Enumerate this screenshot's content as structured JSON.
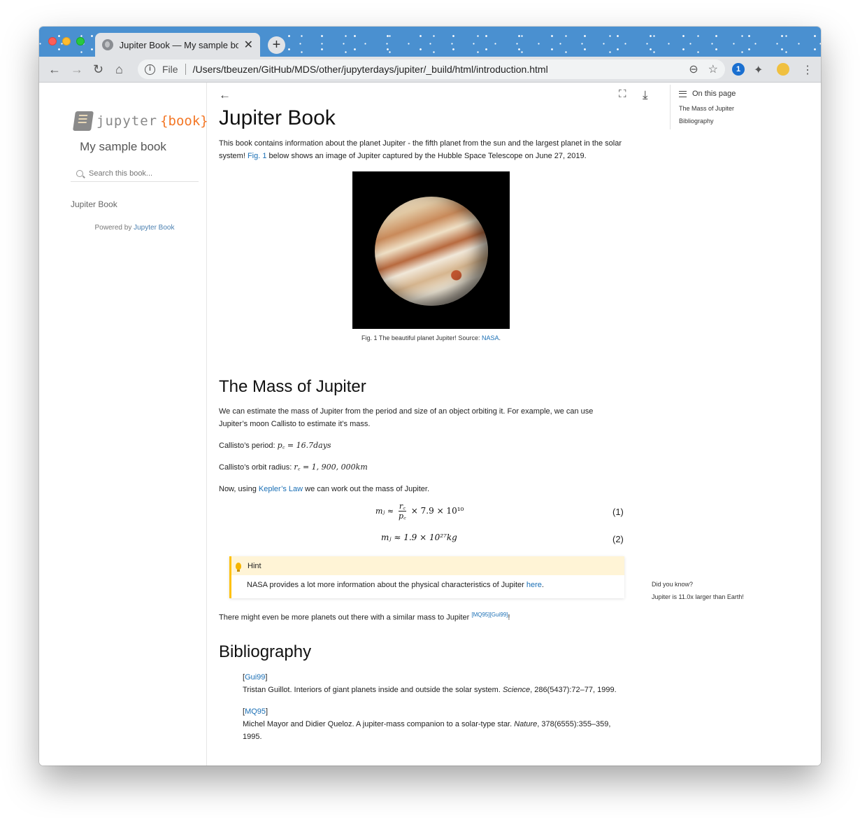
{
  "browser": {
    "tab_title": "Jupiter Book — My sample book",
    "address_scheme": "File",
    "address_url": "/Users/tbeuzen/GitHub/MDS/other/jupyterdays/jupiter/_build/html/introduction.html",
    "onepassword_label": "1"
  },
  "sidebar": {
    "logo_word": "jupyter",
    "logo_book_word": "{book}",
    "site_title": "My sample book",
    "search_placeholder": "Search this book...",
    "nav_items": [
      "Jupiter Book"
    ],
    "powered_prefix": "Powered by ",
    "powered_link": "Jupyter Book"
  },
  "toc": {
    "heading": "On this page",
    "items": [
      "The Mass of Jupiter",
      "Bibliography"
    ]
  },
  "article": {
    "title": "Jupiter Book",
    "intro_pre": "This book contains information about the planet Jupiter - the fifth planet from the sun and the largest planet in the solar system! ",
    "intro_link": "Fig. 1",
    "intro_post": " below shows an image of Jupiter captured by the Hubble Space Telescope on June 27, 2019.",
    "figure_caption_pre": "Fig. 1 The beautiful planet Jupiter! Source: ",
    "figure_caption_link": "NASA",
    "figure_caption_post": ".",
    "section1_title": "The Mass of Jupiter",
    "mass_paragraph": "We can estimate the mass of Jupiter from the period and size of an object orbiting it. For example, we can use Jupiter’s moon Callisto to estimate it’s mass.",
    "period_label": "Callisto’s period: ",
    "period_math": "p꜀ = 16.7days",
    "radius_label": "Callisto’s orbit radius: ",
    "radius_math": "r꜀ = 1, 900, 000km",
    "kepler_pre": "Now, using ",
    "kepler_link": "Kepler’s Law",
    "kepler_post": " we can work out the mass of Jupiter.",
    "eq1_lhs": "mⱼ ≈",
    "eq1_num": "r꜀",
    "eq1_den": "p꜀",
    "eq1_rhs": "× 7.9 × 10¹⁰",
    "eq1_number": "(1)",
    "eq2": "mⱼ ≈ 1.9 × 10²⁷kg",
    "eq2_number": "(2)",
    "hint_title": "Hint",
    "hint_body_pre": "NASA provides a lot more information about the physical characteristics of Jupiter ",
    "hint_body_link": "here",
    "hint_body_post": ".",
    "planets_pre": "There might even be more planets out there with a similar mass to Jupiter ",
    "planets_cite": "[MQ95][Gui99]",
    "planets_post": "!",
    "section2_title": "Bibliography",
    "bib": [
      {
        "key": "Gui99",
        "text_pre": "Tristan Guillot. Interiors of giant planets inside and outside the solar system. ",
        "journal": "Science",
        "text_post": ", 286(5437):72–77, 1999."
      },
      {
        "key": "MQ95",
        "text_pre": "Michel Mayor and Didier Queloz. A jupiter-mass companion to a solar-type star. ",
        "journal": "Nature",
        "text_post": ", 378(6555):355–359, 1995."
      }
    ],
    "margin_note_title": "Did you know?",
    "margin_note_body": "Jupiter is 11.0x larger than Earth!"
  }
}
